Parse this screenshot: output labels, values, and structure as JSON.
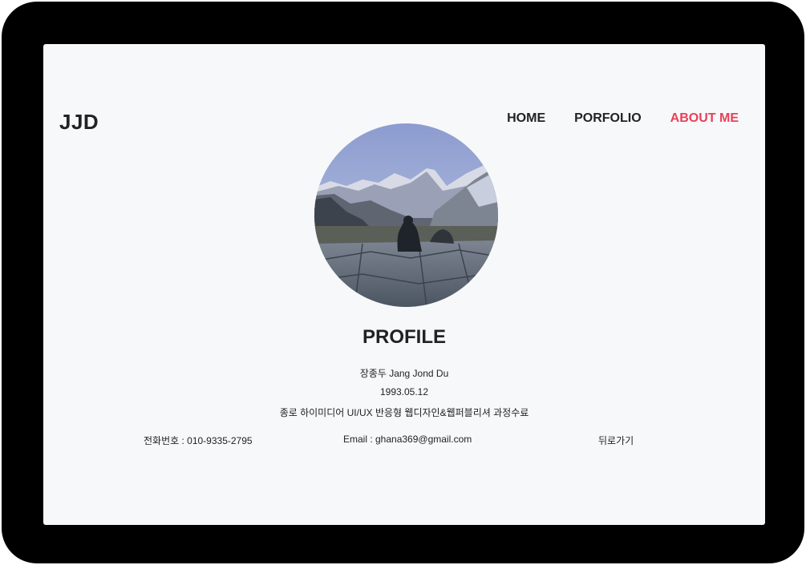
{
  "site": {
    "logo": "JJD"
  },
  "nav": {
    "items": [
      {
        "label": "HOME"
      },
      {
        "label": "PORFOLIO"
      },
      {
        "label": "ABOUT ME"
      }
    ],
    "active_color": "#e8405a"
  },
  "profile": {
    "photo_icon": "mountain-landscape-photo",
    "title": "PROFILE",
    "name": "장종두 Jang Jond Du",
    "birthdate": "1993.05.12",
    "education": "종로 하이미디어 UI/UX 반응형 웹디자인&웹퍼블리셔 과정수료",
    "phone": "전화번호 : 010-9335-2795",
    "email": "Email : ghana369@gmail.com",
    "back_label": "뒤로가기"
  },
  "colors": {
    "frame": "#000000",
    "screen_bg": "#f7f8fa",
    "text": "#222222",
    "accent": "#e8405a"
  }
}
